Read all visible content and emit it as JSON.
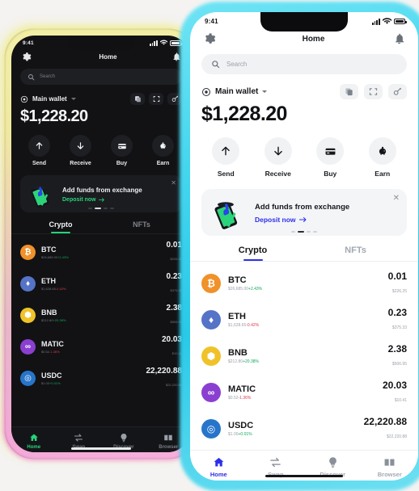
{
  "background_color": "#f4f3f2",
  "phones": {
    "dark": {
      "theme_name": "dark",
      "accent": "#27d37a",
      "glow": "yellow-to-pink",
      "status": {
        "time": "9:41"
      },
      "header": {
        "title": "Home",
        "gear_icon": "gear-icon",
        "bell_icon": "bell-icon"
      },
      "search": {
        "placeholder": "Search"
      },
      "wallet": {
        "name": "Main wallet",
        "balance": "$1,228.20",
        "icons": [
          "copy-icon",
          "scan-icon",
          "connect-icon"
        ]
      },
      "actions": [
        {
          "label": "Send",
          "icon": "arrow-up-icon"
        },
        {
          "label": "Receive",
          "icon": "arrow-down-icon"
        },
        {
          "label": "Buy",
          "icon": "credit-card-icon"
        },
        {
          "label": "Earn",
          "icon": "piggy-bank-icon"
        }
      ],
      "promo": {
        "title": "Add funds from exchange",
        "cta": "Deposit now",
        "close": "✕"
      },
      "tabs": [
        {
          "label": "Crypto",
          "active": true
        },
        {
          "label": "NFTs",
          "active": false
        }
      ],
      "assets": [
        {
          "symbol": "BTC",
          "price": "$26,685.00",
          "change": "+2.43%",
          "dir": "up",
          "amount": "0.01",
          "usd": "$226.25",
          "color": "#f0912a",
          "glyph": "₿"
        },
        {
          "symbol": "ETH",
          "price": "$1,628.65",
          "change": "-0.42%",
          "dir": "down",
          "amount": "0.23",
          "usd": "$375.33",
          "color": "#5573c7",
          "glyph": "♦"
        },
        {
          "symbol": "BNB",
          "price": "$212.80",
          "change": "+20.38%",
          "dir": "up",
          "amount": "2.38",
          "usd": "$506.95",
          "color": "#f0c22a",
          "glyph": "⬢"
        },
        {
          "symbol": "MATIC",
          "price": "$0.52",
          "change": "-1.36%",
          "dir": "down",
          "amount": "20.03",
          "usd": "$10.41",
          "color": "#8a3fd1",
          "glyph": "∞"
        },
        {
          "symbol": "USDC",
          "price": "$1.00",
          "change": "+0.01%",
          "dir": "up",
          "amount": "22,220.88",
          "usd": "$22,220.88",
          "color": "#2775ca",
          "glyph": "◎"
        }
      ],
      "nav": [
        {
          "label": "Home",
          "icon": "home-icon",
          "active": true
        },
        {
          "label": "Swap",
          "icon": "swap-icon",
          "active": false
        },
        {
          "label": "Discover",
          "icon": "bulb-icon",
          "active": false
        },
        {
          "label": "Browser",
          "icon": "browser-icon",
          "active": false
        }
      ]
    },
    "light": {
      "theme_name": "light",
      "accent": "#2b30e8",
      "glow": "cyan",
      "status": {
        "time": "9:41"
      },
      "header": {
        "title": "Home",
        "gear_icon": "gear-icon",
        "bell_icon": "bell-icon"
      },
      "search": {
        "placeholder": "Search"
      },
      "wallet": {
        "name": "Main wallet",
        "balance": "$1,228.20",
        "icons": [
          "copy-icon",
          "scan-icon",
          "connect-icon"
        ]
      },
      "actions": [
        {
          "label": "Send",
          "icon": "arrow-up-icon"
        },
        {
          "label": "Receive",
          "icon": "arrow-down-icon"
        },
        {
          "label": "Buy",
          "icon": "credit-card-icon"
        },
        {
          "label": "Earn",
          "icon": "piggy-bank-icon"
        }
      ],
      "promo": {
        "title": "Add funds from exchange",
        "cta": "Deposit now",
        "close": "✕"
      },
      "tabs": [
        {
          "label": "Crypto",
          "active": true
        },
        {
          "label": "NFTs",
          "active": false
        }
      ],
      "assets": [
        {
          "symbol": "BTC",
          "price": "$26,685.00",
          "change": "+2.43%",
          "dir": "up",
          "amount": "0.01",
          "usd": "$226.25",
          "color": "#f0912a",
          "glyph": "₿"
        },
        {
          "symbol": "ETH",
          "price": "$1,628.65",
          "change": "-0.42%",
          "dir": "down",
          "amount": "0.23",
          "usd": "$375.33",
          "color": "#5573c7",
          "glyph": "♦"
        },
        {
          "symbol": "BNB",
          "price": "$212.80",
          "change": "+20.38%",
          "dir": "up",
          "amount": "2.38",
          "usd": "$506.95",
          "color": "#f0c22a",
          "glyph": "⬢"
        },
        {
          "symbol": "MATIC",
          "price": "$0.52",
          "change": "-1.36%",
          "dir": "down",
          "amount": "20.03",
          "usd": "$10.41",
          "color": "#8a3fd1",
          "glyph": "∞"
        },
        {
          "symbol": "USDC",
          "price": "$1.00",
          "change": "+0.01%",
          "dir": "up",
          "amount": "22,220.88",
          "usd": "$22,220.88",
          "color": "#2775ca",
          "glyph": "◎"
        }
      ],
      "nav": [
        {
          "label": "Home",
          "icon": "home-icon",
          "active": true
        },
        {
          "label": "Swap",
          "icon": "swap-icon",
          "active": false
        },
        {
          "label": "Discover",
          "icon": "bulb-icon",
          "active": false
        },
        {
          "label": "Browser",
          "icon": "browser-icon",
          "active": false
        }
      ]
    }
  }
}
